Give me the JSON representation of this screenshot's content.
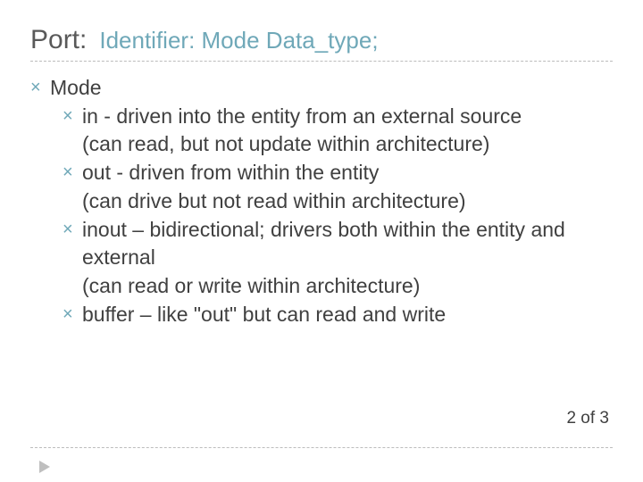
{
  "title": {
    "port": "Port:",
    "rest": "Identifier:  Mode Data_type;"
  },
  "outline": {
    "heading": "Mode",
    "items": [
      {
        "main": "in - driven into the entity from an external source",
        "note": "(can read, but not update within architecture)"
      },
      {
        "main": "out - driven from within the entity",
        "note": "(can drive but not read within architecture)"
      },
      {
        "main": "inout – bidirectional;  drivers both within the entity and external",
        "note": "(can read or write within architecture)"
      },
      {
        "main": "buffer – like \"out\" but can read and write",
        "note": ""
      }
    ]
  },
  "footer": "2 of 3",
  "bullets": {
    "l1": "×",
    "l2": "×"
  },
  "colors": {
    "accent": "#6fa8b8",
    "text": "#404040",
    "title_dark": "#595959"
  }
}
